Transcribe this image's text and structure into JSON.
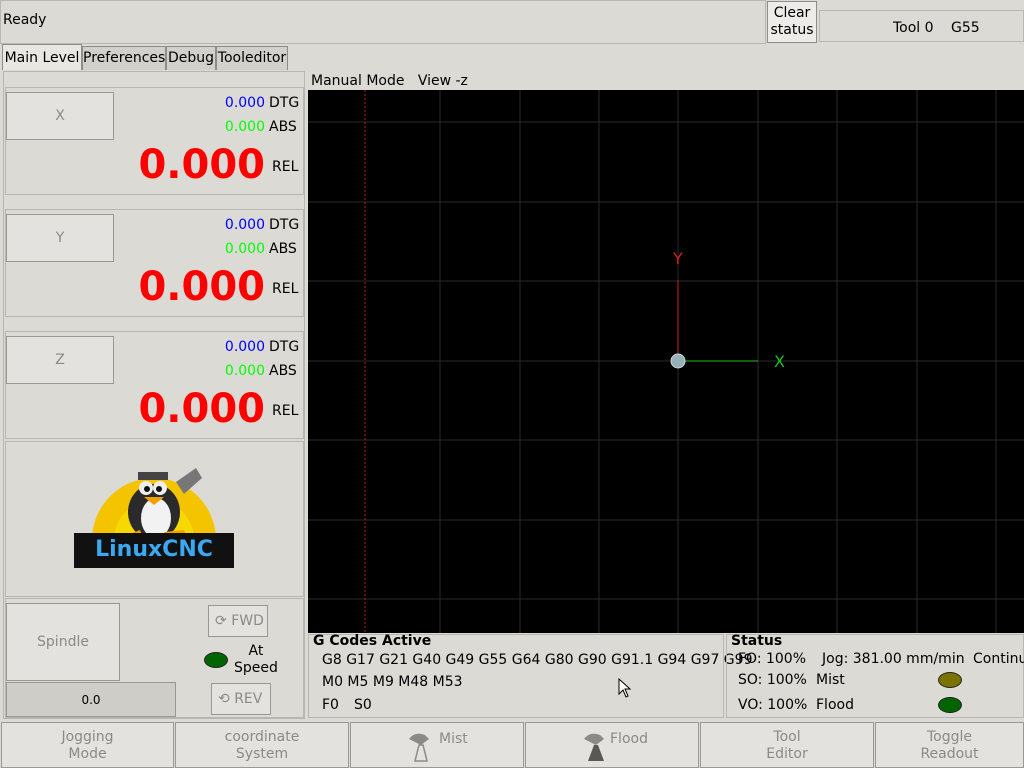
{
  "status": {
    "text": "Ready"
  },
  "clear_button": {
    "line1": "Clear",
    "line2": "status"
  },
  "tool_info": {
    "tool": "Tool 0",
    "coord_system": "G55"
  },
  "tabs": [
    {
      "label": "Main Level"
    },
    {
      "label": "Preferences"
    },
    {
      "label": "Debug"
    },
    {
      "label": "Tooleditor"
    }
  ],
  "axes": [
    {
      "name": "X",
      "dtg": "0.000",
      "abs": "0.000",
      "rel": "0.000"
    },
    {
      "name": "Y",
      "dtg": "0.000",
      "abs": "0.000",
      "rel": "0.000"
    },
    {
      "name": "Z",
      "dtg": "0.000",
      "abs": "0.000",
      "rel": "0.000"
    }
  ],
  "axis_labels": {
    "dtg": "DTG",
    "abs": "ABS",
    "rel": "REL"
  },
  "logo": {
    "text": "LinuxCNC"
  },
  "spindle": {
    "label": "Spindle",
    "speed": "0.0",
    "fwd": "FWD",
    "rev": "REV",
    "at_speed_line1": "At",
    "at_speed_line2": "Speed"
  },
  "graphics": {
    "mode": "Manual Mode",
    "view": "View -z",
    "x_axis": "X",
    "y_axis": "Y"
  },
  "gcodes": {
    "title": "G Codes Active",
    "line1": "G8 G17 G21 G40 G49 G55 G64 G80 G90 G91.1 G94 G97 G99",
    "line2": "M0 M5 M9 M48 M53",
    "line3_f": "F0",
    "line3_s": "S0"
  },
  "status_panel": {
    "title": "Status",
    "fo": "FO: 100%",
    "so": "SO: 100%",
    "vo": "VO: 100%",
    "jog": "Jog: 381.00 mm/min",
    "jog_mode": "Continuous",
    "mist": "Mist",
    "flood": "Flood"
  },
  "bottom_buttons": [
    {
      "line1": "Jogging",
      "line2": "Mode"
    },
    {
      "line1": "coordinate",
      "line2": "System"
    },
    {
      "line1": "Mist",
      "line2": ""
    },
    {
      "line1": "Flood",
      "line2": ""
    },
    {
      "line1": "Tool",
      "line2": "Editor"
    },
    {
      "line1": "Toggle",
      "line2": "Readout"
    }
  ],
  "colors": {
    "dtg": "#0000ff",
    "abs": "#00ff00",
    "rel": "#ff0000",
    "mist_led": "#7a7300",
    "flood_led": "#006400",
    "at_speed_led": "#006400"
  }
}
